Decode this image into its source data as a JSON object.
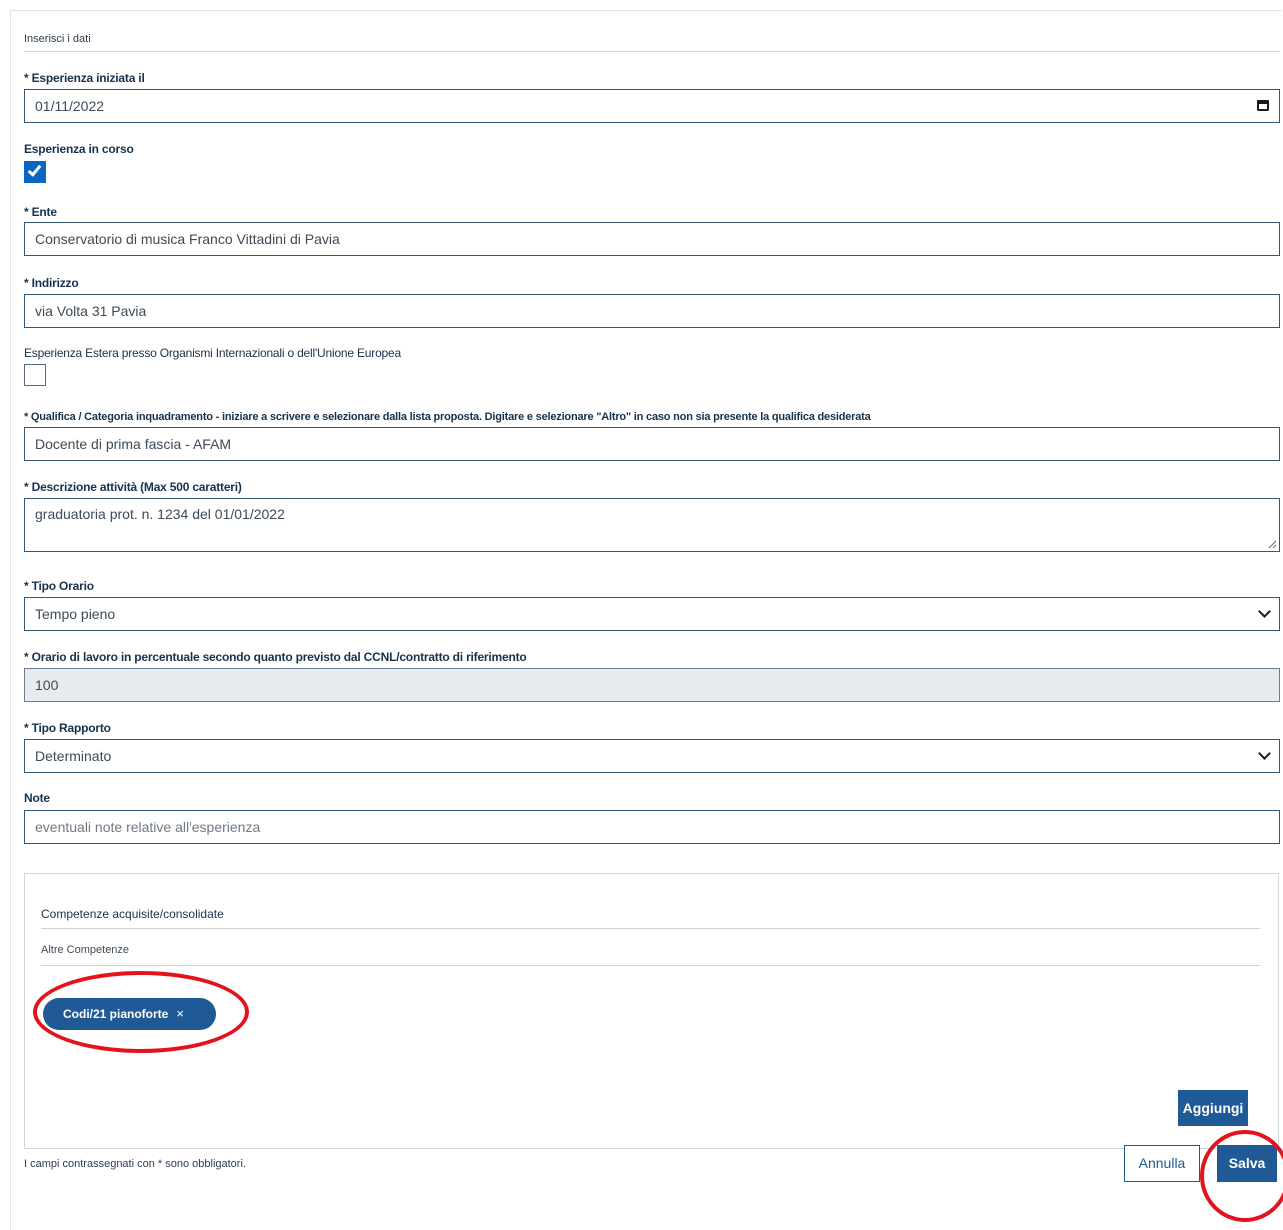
{
  "form": {
    "section_title": "Inserisci i dati",
    "start_date": {
      "label": "* Esperienza iniziata il",
      "value": "01/11/2022"
    },
    "in_progress": {
      "label": "Esperienza in corso",
      "checked": true
    },
    "ente": {
      "label": "* Ente",
      "value": "Conservatorio di musica Franco Vittadini di Pavia"
    },
    "indirizzo": {
      "label": "* Indirizzo",
      "value": "via Volta 31 Pavia"
    },
    "estera": {
      "label": "Esperienza Estera presso Organismi Internazionali o dell'Unione Europea",
      "checked": false
    },
    "qualifica": {
      "label": "* Qualifica / Categoria inquadramento - iniziare a scrivere e selezionare dalla lista proposta. Digitare e selezionare \"Altro\" in caso non sia presente la qualifica desiderata",
      "value": "Docente di prima fascia - AFAM"
    },
    "descrizione": {
      "label": "* Descrizione attività (Max 500 caratteri)",
      "value": "graduatoria prot. n. 1234 del 01/01/2022"
    },
    "tipo_orario": {
      "label": "* Tipo Orario",
      "value": "Tempo pieno"
    },
    "percentuale": {
      "label": "* Orario di lavoro in percentuale secondo quanto previsto dal CCNL/contratto di riferimento",
      "value": "100"
    },
    "tipo_rapporto": {
      "label": "* Tipo Rapporto",
      "value": "Determinato"
    },
    "note": {
      "label": "Note",
      "placeholder": "eventuali note relative all'esperienza"
    }
  },
  "competenze": {
    "title": "Competenze acquisite/consolidate",
    "subtitle": "Altre Competenze",
    "chips": [
      {
        "label": "Codi/21 pianoforte",
        "close": "×"
      }
    ],
    "add_button": "Aggiungi"
  },
  "footer": {
    "note": "I campi contrassegnati con * sono obbligatori.",
    "cancel_button": "Annulla",
    "save_button": "Salva"
  },
  "colors": {
    "primary": "#1f5a96",
    "checkbox_checked": "#0b66c3",
    "annotation_red": "#e3131b",
    "disabled_bg": "#e7eaee"
  }
}
